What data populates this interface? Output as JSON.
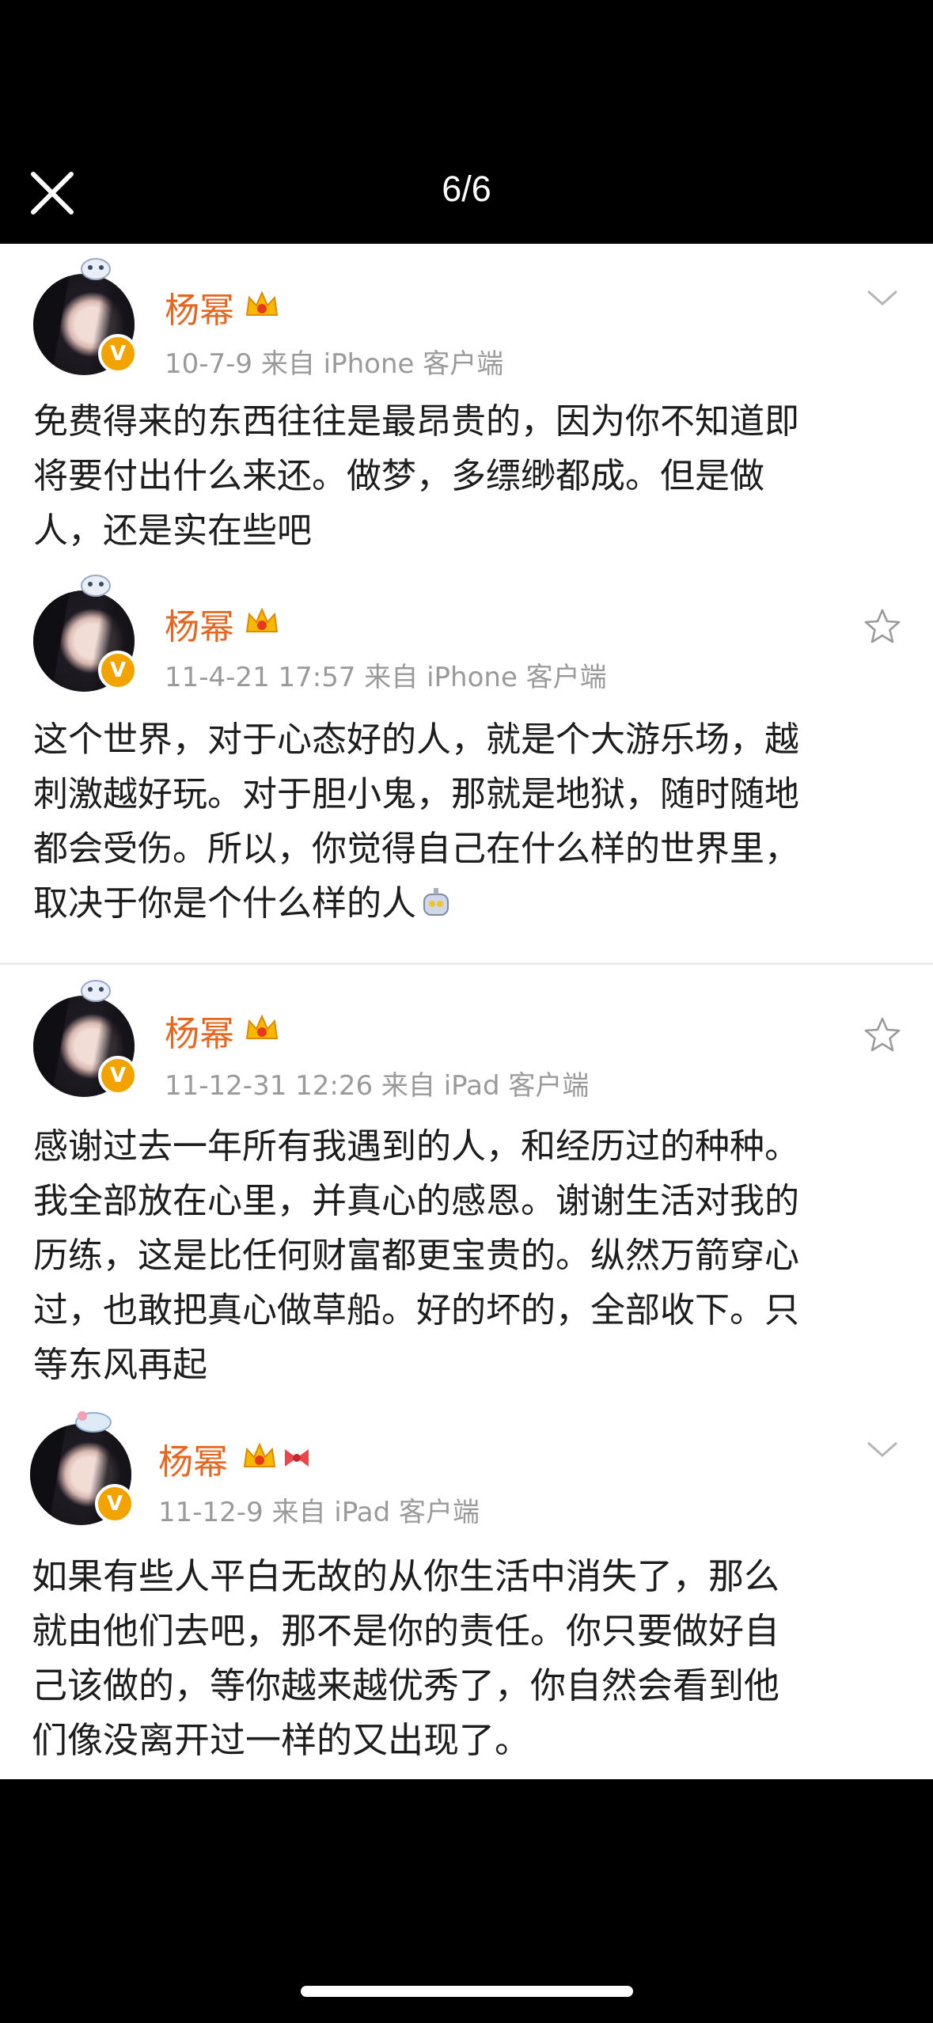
{
  "viewer": {
    "counter": "6/6"
  },
  "posts": [
    {
      "author": "杨幂",
      "meta": "10-7-9  来自 iPhone 客户端",
      "action_icon": "chevron-down-icon",
      "lines": [
        "免费得来的东西往往是最昂贵的，因为你不知道即",
        "将要付出什么来还。做梦，多缥缈都成。但是做",
        "人，还是实在些吧"
      ]
    },
    {
      "author": "杨幂",
      "meta": "11-4-21 17:57  来自 iPhone 客户端",
      "action_icon": "star-icon",
      "lines": [
        "这个世界，对于心态好的人，就是个大游乐场，越",
        "刺激越好玩。对于胆小鬼，那就是地狱，随时随地",
        "都会受伤。所以，你觉得自己在什么样的世界里，",
        "取决于你是个什么样的人"
      ]
    },
    {
      "author": "杨幂",
      "meta": "11-12-31 12:26  来自 iPad 客户端",
      "action_icon": "star-icon",
      "lines": [
        "感谢过去一年所有我遇到的人，和经历过的种种。",
        "我全部放在心里，并真心的感恩。谢谢生活对我的",
        "历练，这是比任何财富都更宝贵的。纵然万箭穿心",
        "过，也敢把真心做草船。好的坏的，全部收下。只",
        "等东风再起"
      ]
    },
    {
      "author": "杨幂",
      "meta": "11-12-9  来自 iPad 客户端",
      "action_icon": "chevron-down-icon",
      "lines": [
        "如果有些人平白无故的从你生活中消失了，那么",
        "就由他们去吧，那不是你的责任。你只要做好自",
        "己该做的，等你越来越优秀了，你自然会看到他",
        "们像没离开过一样的又出现了。"
      ]
    }
  ],
  "colors": {
    "name": "#e7661f",
    "meta": "#9a9a9a",
    "text": "#1d1d1d",
    "badge": "#f2a300"
  }
}
